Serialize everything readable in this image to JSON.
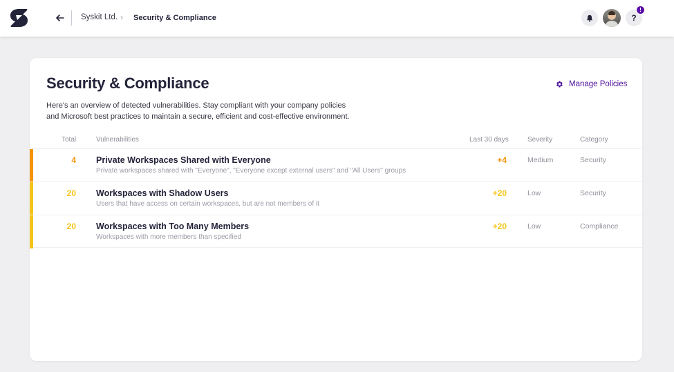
{
  "header": {
    "breadcrumb": {
      "org": "Syskit Ltd.",
      "separator": "›",
      "current": "Security & Compliance"
    },
    "help_label": "?",
    "notification_badge": "!"
  },
  "page": {
    "title": "Security & Compliance",
    "manage_policies_label": "Manage Policies",
    "description": "Here's an overview of detected vulnerabilities. Stay compliant with your company policies and Microsoft best practices to maintain a secure, efficient and cost-effective environment."
  },
  "table": {
    "columns": {
      "total": "Total",
      "vulnerabilities": "Vulnerabilities",
      "last_30_days": "Last 30 days",
      "severity": "Severity",
      "category": "Category"
    },
    "rows": [
      {
        "total": "4",
        "title": "Private Workspaces Shared with Everyone",
        "description": "Private workspaces shared with \"Everyone\", \"Everyone except external users\" and \"All Users\" groups",
        "last_30_days": "+4",
        "severity": "Medium",
        "category": "Security",
        "color": "#f5930a"
      },
      {
        "total": "20",
        "title": "Workspaces with Shadow Users",
        "description": "Users that have access on certain workspaces, but are not members of it",
        "last_30_days": "+20",
        "severity": "Low",
        "category": "Security",
        "color": "#f5c518"
      },
      {
        "total": "20",
        "title": "Workspaces with Too Many Members",
        "description": "Workspaces with more members than specified",
        "last_30_days": "+20",
        "severity": "Low",
        "category": "Compliance",
        "color": "#f5c518"
      }
    ]
  },
  "icons": {
    "logo": "syskit-logo",
    "back": "arrow-left-icon",
    "bell": "bell-icon",
    "gear": "gear-icon",
    "help": "question-icon"
  },
  "colors": {
    "accent": "#4b0c9a",
    "badge": "#5a0fa8",
    "value_medium": "#f5930a",
    "value_low": "#f5c518"
  }
}
